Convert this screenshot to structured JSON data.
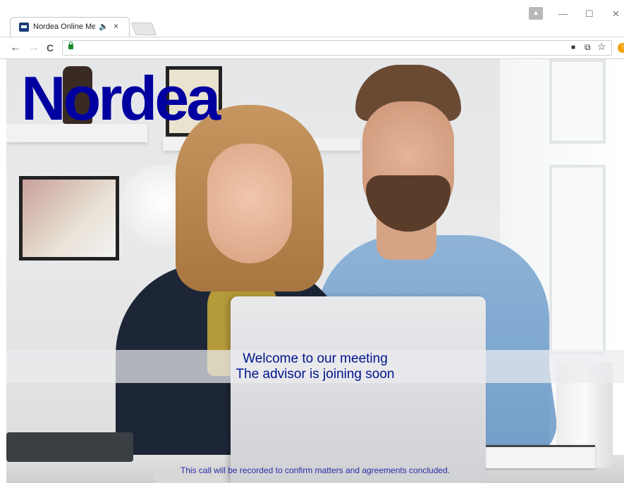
{
  "browser": {
    "tab_title": "Nordea Online Meetin",
    "tab_audio_icon": "🔈",
    "tab_close": "×",
    "window_minimize": "—",
    "window_maximize": "☐",
    "window_close": "✕",
    "nav_back": "←",
    "nav_forward": "→",
    "nav_reload": "C",
    "camera_icon": "■",
    "translate_icon": "⧉",
    "star_icon": "☆",
    "ext_badge": "!",
    "profile_icon": "▲"
  },
  "page": {
    "logo_text": "Nordea",
    "welcome_line1": "Welcome to our meeting",
    "welcome_line2": "The advisor is joining soon",
    "footer_notice": "This call will be recorded to confirm matters and agreements concluded."
  },
  "colors": {
    "brand": "#0000a0",
    "banner_text": "#00148c"
  }
}
